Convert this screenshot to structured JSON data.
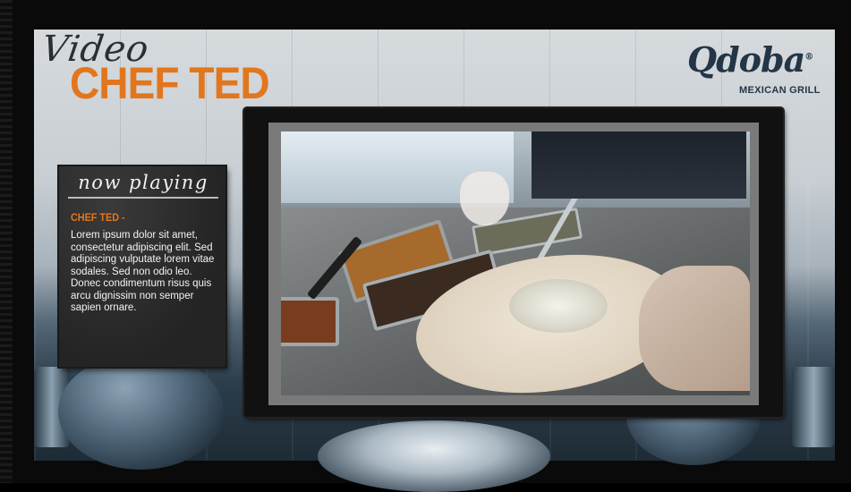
{
  "page": {
    "title_script": "Video",
    "title_main": "CHEF TED"
  },
  "logo": {
    "main": "Qdoba",
    "registered": "®",
    "sub": "MEXICAN GRILL"
  },
  "now_playing": {
    "heading": "now playing",
    "subtitle": "CHEF TED -",
    "body": "Lorem ipsum dolor sit amet, consectetur adipiscing elit. Sed adipiscing vulputate lorem vitae sodales. Sed non odio leo. Donec condimentum risus quis arcu dignissim non semper sapien ornare."
  },
  "colors": {
    "accent_orange": "#e2761d",
    "logo_navy": "#233546",
    "panel_dark": "#2b2b2b"
  },
  "icons": [
    "video-frame"
  ]
}
